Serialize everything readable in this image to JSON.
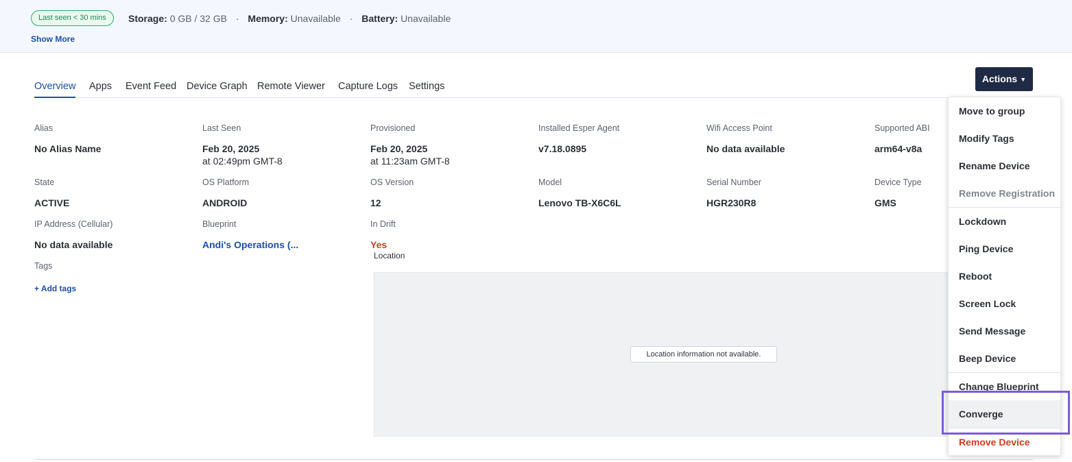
{
  "status": {
    "badge": "Last seen < 30 mins",
    "storage_label": "Storage:",
    "storage_value": "0 GB / 32 GB",
    "memory_label": "Memory:",
    "memory_value": "Unavailable",
    "battery_label": "Battery:",
    "battery_value": "Unavailable",
    "separator": "·",
    "show_more": "Show More"
  },
  "tabs": [
    {
      "label": "Overview",
      "active": true
    },
    {
      "label": "Apps"
    },
    {
      "label": "Event Feed"
    },
    {
      "label": "Device Graph"
    },
    {
      "label": "Remote Viewer"
    },
    {
      "label": "Capture Logs"
    },
    {
      "label": "Settings"
    }
  ],
  "actions": {
    "label": "Actions",
    "caret": "▼",
    "menu": [
      {
        "label": "Move to group"
      },
      {
        "label": "Modify Tags"
      },
      {
        "label": "Rename Device"
      },
      {
        "label": "Remove Registration",
        "disabled": true
      },
      {
        "label": "Lockdown"
      },
      {
        "label": "Ping Device"
      },
      {
        "label": "Reboot"
      },
      {
        "label": "Screen Lock"
      },
      {
        "label": "Send Message"
      },
      {
        "label": "Beep Device"
      },
      {
        "label": "Change Blueprint"
      },
      {
        "label": "Converge",
        "highlighted": true
      },
      {
        "label": "Remove Device",
        "danger": true
      }
    ]
  },
  "details": {
    "alias": {
      "label": "Alias",
      "value": "No Alias Name"
    },
    "last_seen": {
      "label": "Last Seen",
      "value": "Feb 20, 2025",
      "sub": "at 02:49pm GMT-8"
    },
    "provisioned": {
      "label": "Provisioned",
      "value": "Feb 20, 2025",
      "sub": "at 11:23am GMT-8"
    },
    "agent": {
      "label": "Installed Esper Agent",
      "value": "v7.18.0895"
    },
    "wifi": {
      "label": "Wifi Access Point",
      "value": "No data available"
    },
    "abi": {
      "label": "Supported ABI",
      "value": "arm64-v8a"
    },
    "state": {
      "label": "State",
      "value": "ACTIVE"
    },
    "os_platform": {
      "label": "OS Platform",
      "value": "ANDROID"
    },
    "os_version": {
      "label": "OS Version",
      "value": "12"
    },
    "model": {
      "label": "Model",
      "value": "Lenovo TB-X6C6L"
    },
    "serial": {
      "label": "Serial Number",
      "value": "HGR230R8"
    },
    "device_type": {
      "label": "Device Type",
      "value": "GMS"
    },
    "ip": {
      "label": "IP Address (Cellular)",
      "value": "No data available"
    },
    "blueprint": {
      "label": "Blueprint",
      "value": "Andi's Operations (..."
    },
    "drift": {
      "label": "In Drift",
      "value": "Yes"
    },
    "tags": {
      "label": "Tags",
      "add": "+ Add tags"
    },
    "location": {
      "label": "Location",
      "notice": "Location information not available."
    }
  }
}
